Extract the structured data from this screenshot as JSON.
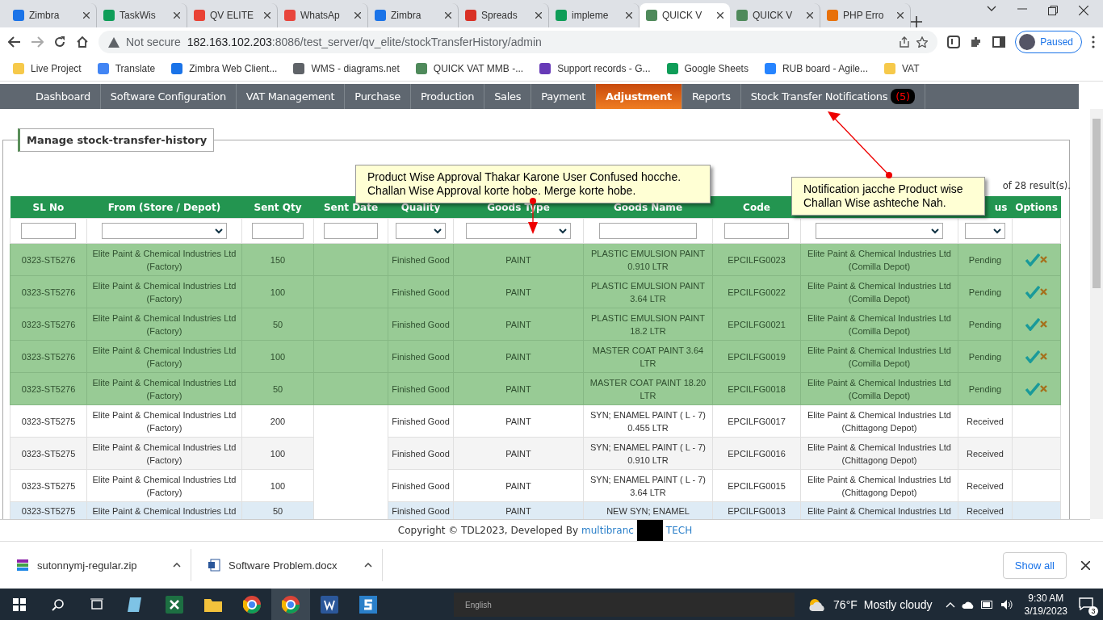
{
  "browser": {
    "tabs": [
      {
        "title": "Zimbra",
        "color": "#1a73e8",
        "selected": false
      },
      {
        "title": "TaskWis",
        "color": "#0f9d58",
        "selected": false
      },
      {
        "title": "QV ELITE",
        "color": "#e94235",
        "selected": false
      },
      {
        "title": "WhatsAp",
        "color": "#e8453c",
        "selected": false
      },
      {
        "title": "Zimbra",
        "color": "#1a73e8",
        "selected": false
      },
      {
        "title": "Spreads",
        "color": "#d93025",
        "selected": false
      },
      {
        "title": "impleme",
        "color": "#0f9d58",
        "selected": false
      },
      {
        "title": "QUICK V",
        "color": "#4f8a5b",
        "selected": true
      },
      {
        "title": "QUICK V",
        "color": "#4f8a5b",
        "selected": false
      },
      {
        "title": "PHP Erro",
        "color": "#e8710a",
        "selected": false
      }
    ],
    "security": "Not secure",
    "url_host": "182.163.102.203",
    "url_path": ":8086/test_server/qv_elite/stockTransferHistory/admin",
    "profile": "Paused",
    "bookmarks": [
      {
        "label": "Live Project",
        "color": "#f6c94a"
      },
      {
        "label": "Translate",
        "color": "#4285f4"
      },
      {
        "label": "Zimbra Web Client...",
        "color": "#1a73e8"
      },
      {
        "label": "WMS - diagrams.net",
        "color": "#5f6368"
      },
      {
        "label": "QUICK VAT MMB -...",
        "color": "#4f8a5b"
      },
      {
        "label": "Support records - G...",
        "color": "#673ab7"
      },
      {
        "label": "Google Sheets",
        "color": "#0f9d58"
      },
      {
        "label": "RUB board - Agile...",
        "color": "#2684ff"
      },
      {
        "label": "VAT",
        "color": "#f6c94a"
      }
    ]
  },
  "nav": {
    "items": [
      {
        "label": "Dashboard",
        "selected": false
      },
      {
        "label": "Software Configuration",
        "selected": false
      },
      {
        "label": "VAT Management",
        "selected": false
      },
      {
        "label": "Purchase",
        "selected": false
      },
      {
        "label": "Production",
        "selected": false
      },
      {
        "label": "Sales",
        "selected": false
      },
      {
        "label": "Payment",
        "selected": false
      },
      {
        "label": "Adjustment",
        "selected": true
      },
      {
        "label": "Reports",
        "selected": false
      },
      {
        "label": "Stock Transfer Notifications",
        "selected": false,
        "badge": "(5)"
      }
    ]
  },
  "panel": {
    "title": "Manage stock-transfer-history",
    "results": "of 28 result(s)."
  },
  "table": {
    "columns": [
      {
        "label": "SL No",
        "kind": "text"
      },
      {
        "label": "From (Store / Depot)",
        "kind": "select"
      },
      {
        "label": "Sent Qty",
        "kind": "text"
      },
      {
        "label": "Sent Date",
        "kind": "text"
      },
      {
        "label": "Quality",
        "kind": "select"
      },
      {
        "label": "Goods Type",
        "kind": "select"
      },
      {
        "label": "Goods Name",
        "kind": "text"
      },
      {
        "label": "Code",
        "kind": "text"
      },
      {
        "kind": "select"
      },
      {
        "label": "us",
        "kind": "select"
      },
      {
        "label": "Options",
        "kind": "none"
      }
    ],
    "rows": [
      {
        "sl_no": "0323-ST5276",
        "from": "Elite Paint & Chemical Industries Ltd (Factory)",
        "sent_qty": "150",
        "quality": "Finished Good",
        "goods_type": "PAINT",
        "goods_name": "PLASTIC EMULSION PAINT 0.910 LTR",
        "code": "EPCILFG0023",
        "to": "Elite Paint & Chemical Industries Ltd (Comilla Depot)",
        "status": "Pending",
        "highlighted": true,
        "selected": false,
        "approvable": true
      },
      {
        "sl_no": "0323-ST5276",
        "from": "Elite Paint & Chemical Industries Ltd (Factory)",
        "sent_qty": "100",
        "quality": "Finished Good",
        "goods_type": "PAINT",
        "goods_name": "PLASTIC EMULSION PAINT 3.64 LTR",
        "code": "EPCILFG0022",
        "to": "Elite Paint & Chemical Industries Ltd (Comilla Depot)",
        "status": "Pending",
        "highlighted": true,
        "selected": false,
        "approvable": true
      },
      {
        "sl_no": "0323-ST5276",
        "from": "Elite Paint & Chemical Industries Ltd (Factory)",
        "sent_qty": "50",
        "quality": "Finished Good",
        "goods_type": "PAINT",
        "goods_name": "PLASTIC EMULSION PAINT 18.2 LTR",
        "code": "EPCILFG0021",
        "to": "Elite Paint & Chemical Industries Ltd (Comilla Depot)",
        "status": "Pending",
        "highlighted": true,
        "selected": false,
        "approvable": true
      },
      {
        "sl_no": "0323-ST5276",
        "from": "Elite Paint & Chemical Industries Ltd (Factory)",
        "sent_qty": "100",
        "quality": "Finished Good",
        "goods_type": "PAINT",
        "goods_name": "MASTER COAT PAINT 3.64 LTR",
        "code": "EPCILFG0019",
        "to": "Elite Paint & Chemical Industries Ltd (Comilla Depot)",
        "status": "Pending",
        "highlighted": true,
        "selected": false,
        "approvable": true
      },
      {
        "sl_no": "0323-ST5276",
        "from": "Elite Paint & Chemical Industries Ltd (Factory)",
        "sent_qty": "50",
        "quality": "Finished Good",
        "goods_type": "PAINT",
        "goods_name": "MASTER COAT PAINT 18.20 LTR",
        "code": "EPCILFG0018",
        "to": "Elite Paint & Chemical Industries Ltd (Comilla Depot)",
        "status": "Pending",
        "highlighted": true,
        "selected": false,
        "approvable": true
      },
      {
        "sl_no": "0323-ST5275",
        "from": "Elite Paint & Chemical Industries Ltd (Factory)",
        "sent_qty": "200",
        "quality": "Finished Good",
        "goods_type": "PAINT",
        "goods_name": "SYN; ENAMEL PAINT ( L - 7) 0.455 LTR",
        "code": "EPCILFG0017",
        "to": "Elite Paint & Chemical Industries Ltd (Chittagong Depot)",
        "status": "Received",
        "highlighted": false,
        "selected": false,
        "approvable": false
      },
      {
        "sl_no": "0323-ST5275",
        "from": "Elite Paint & Chemical Industries Ltd (Factory)",
        "sent_qty": "100",
        "quality": "Finished Good",
        "goods_type": "PAINT",
        "goods_name": "SYN; ENAMEL PAINT ( L - 7) 0.910 LTR",
        "code": "EPCILFG0016",
        "to": "Elite Paint & Chemical Industries Ltd (Chittagong Depot)",
        "status": "Received",
        "highlighted": false,
        "selected": false,
        "approvable": false
      },
      {
        "sl_no": "0323-ST5275",
        "from": "Elite Paint & Chemical Industries Ltd (Factory)",
        "sent_qty": "100",
        "quality": "Finished Good",
        "goods_type": "PAINT",
        "goods_name": "SYN; ENAMEL PAINT ( L - 7) 3.64 LTR",
        "code": "EPCILFG0015",
        "to": "Elite Paint & Chemical Industries Ltd (Chittagong Depot)",
        "status": "Received",
        "highlighted": false,
        "selected": false,
        "approvable": false
      },
      {
        "sl_no": "0323-ST5275",
        "from": "Elite Paint & Chemical Industries Ltd",
        "sent_qty": "50",
        "quality": "Finished Good",
        "goods_type": "PAINT",
        "goods_name": "NEW SYN; ENAMEL",
        "code": "EPCILFG0013",
        "to": "Elite Paint & Chemical Industries Ltd",
        "status": "Received",
        "highlighted": false,
        "selected": true,
        "approvable": false
      }
    ]
  },
  "annotations": [
    {
      "text": "Product Wise Approval Thakar Karone User Confused hocche.\nChallan Wise Approval korte hobe. Merge korte hobe."
    },
    {
      "text": "Notification jacche Product wise\nChallan Wise ashteche Nah."
    }
  ],
  "footer": {
    "text": "Copyright © TDL2023, Developed By",
    "link": "multibranc",
    "link_tail": "TECH"
  },
  "downloads": {
    "files": [
      {
        "name": "sutonnymj-regular.zip",
        "kind": "archive"
      },
      {
        "name": "Software Problem.docx",
        "kind": "word"
      }
    ],
    "show_all": "Show all"
  },
  "taskbar": {
    "language": "English",
    "temperature": "76°F",
    "weather": "Mostly cloudy",
    "time": "9:30 AM",
    "date": "3/19/2023",
    "notifications": "3"
  }
}
